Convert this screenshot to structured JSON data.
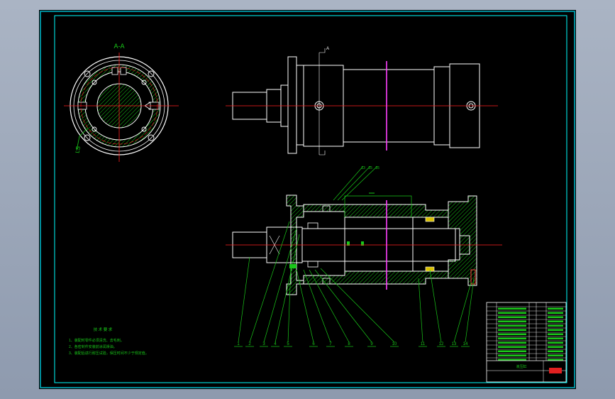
{
  "section_label": "A-A",
  "section_mark": "A",
  "detail_mark": "LS",
  "tech_title": "技 术 要 求",
  "tech_notes": [
    "1、装配时零件必须清洗、去毛刺。",
    "2、各密封件安装前涂润滑油。",
    "3、装配后进行耐压试验，保压时间不少于规定值。"
  ],
  "top_callouts": [
    "13",
    "15",
    "16"
  ],
  "bottom_callouts": [
    "1",
    "2",
    "3",
    "4",
    "5",
    "6",
    "7",
    "8",
    "9",
    "10",
    "11",
    "12",
    "13",
    "14"
  ],
  "title_block_name": "液压缸",
  "colors": {
    "background": "#000000",
    "outline": "#ffffff",
    "centerline": "#ff2020",
    "hatch": "#19c819",
    "leader": "#19c819",
    "accent": "#ff40ff",
    "border": "#00ffff"
  }
}
